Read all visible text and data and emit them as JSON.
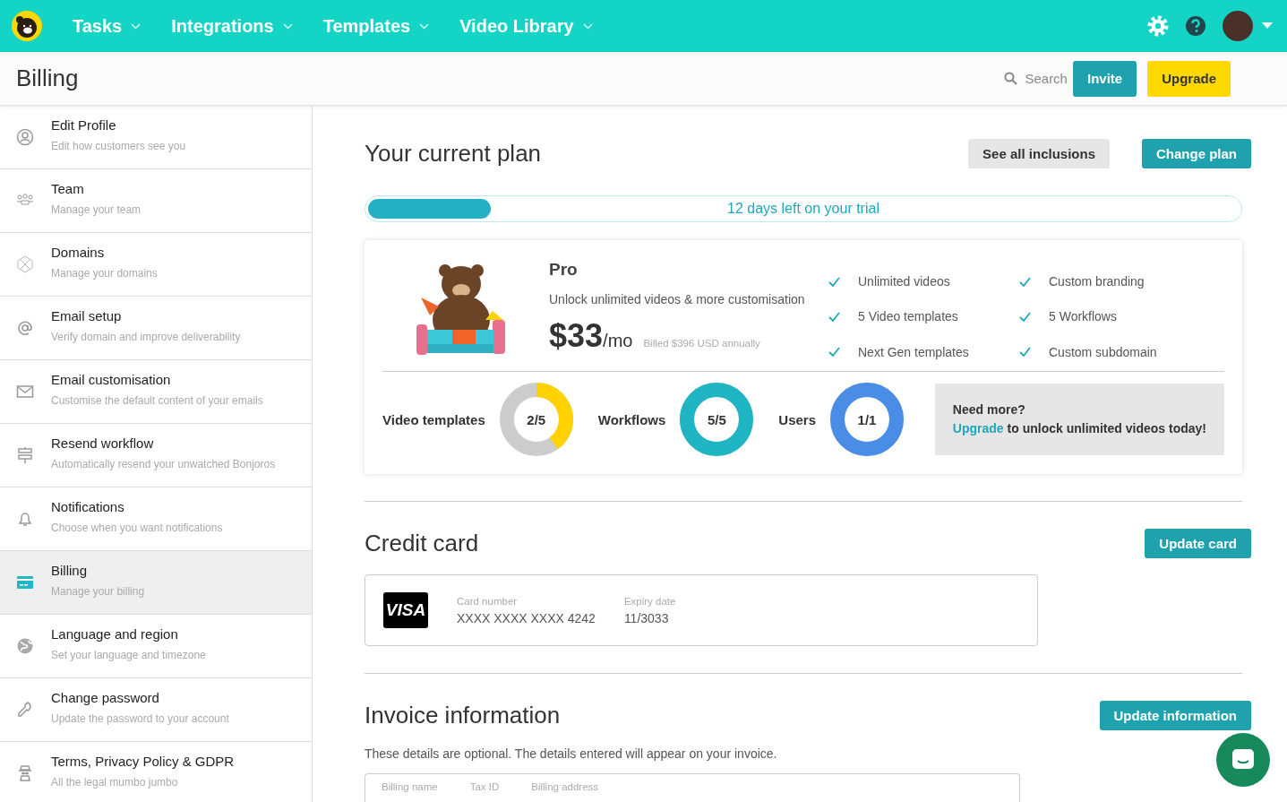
{
  "nav": {
    "items": [
      {
        "label": "Tasks"
      },
      {
        "label": "Integrations"
      },
      {
        "label": "Templates"
      },
      {
        "label": "Video Library"
      }
    ]
  },
  "header": {
    "title": "Billing",
    "search_label": "Search",
    "buttons": [
      "Invite",
      "Upgrade"
    ]
  },
  "sidebar": {
    "items": [
      {
        "title": "Edit Profile",
        "subtitle": "Edit how customers see you",
        "selected": false
      },
      {
        "title": "Team",
        "subtitle": "Manage your team",
        "selected": false
      },
      {
        "title": "Domains",
        "subtitle": "Manage your domains",
        "selected": false
      },
      {
        "title": "Email setup",
        "subtitle": "Verify domain and improve deliverability",
        "selected": false
      },
      {
        "title": "Email customisation",
        "subtitle": "Customise the default content of your emails",
        "selected": false
      },
      {
        "title": "Resend workflow",
        "subtitle": "Automatically resend your unwatched Bonjoros",
        "selected": false
      },
      {
        "title": "Notifications",
        "subtitle": "Choose when you want notifications",
        "selected": false
      },
      {
        "title": "Billing",
        "subtitle": "Manage your billing",
        "selected": true
      },
      {
        "title": "Language and region",
        "subtitle": "Set your language and timezone",
        "selected": false
      },
      {
        "title": "Change password",
        "subtitle": "Update the password to your account",
        "selected": false
      },
      {
        "title": "Terms, Privacy Policy & GDPR",
        "subtitle": "All the legal mumbo jumbo",
        "selected": false
      }
    ]
  },
  "plan": {
    "title": "Your current plan",
    "buttons": [
      "See all inclusions",
      "Change plan"
    ],
    "trial": {
      "level": 0.14,
      "text": "12 days left on your trial"
    },
    "name": "Pro",
    "description": "Unlock unlimited videos & more customisation",
    "price": "$33",
    "per": "/mo",
    "billed": "Billed $396 USD annually",
    "features": [
      "Unlimited videos",
      "Custom branding",
      "5 Video templates",
      "5 Workflows",
      "Next Gen templates",
      "Custom subdomain"
    ],
    "usage": [
      {
        "label": "Video templates",
        "reading": "2/5",
        "level": 0.4,
        "color": "#ffd200"
      },
      {
        "label": "Workflows",
        "reading": "5/5",
        "level": 1,
        "color": "#1fb5c2"
      },
      {
        "label": "Users",
        "reading": "1/1",
        "level": 1,
        "color": "#4a8de6"
      }
    ],
    "upsell": {
      "title": "Need more?",
      "link": "Upgrade",
      "text": " to unlock unlimited videos today!"
    }
  },
  "credit_card": {
    "title": "Credit card",
    "button": "Update card",
    "brand": "VISA",
    "fields": [
      {
        "label": "Card number",
        "value": "XXXX XXXX XXXX 4242"
      },
      {
        "label": "Expiry date",
        "value": "11/3033"
      }
    ]
  },
  "invoice": {
    "title": "Invoice information",
    "button": "Update information",
    "note": "These details are optional. The details entered will appear on your invoice.",
    "fields": [
      "Billing name",
      "Tax ID",
      "Billing address"
    ]
  }
}
